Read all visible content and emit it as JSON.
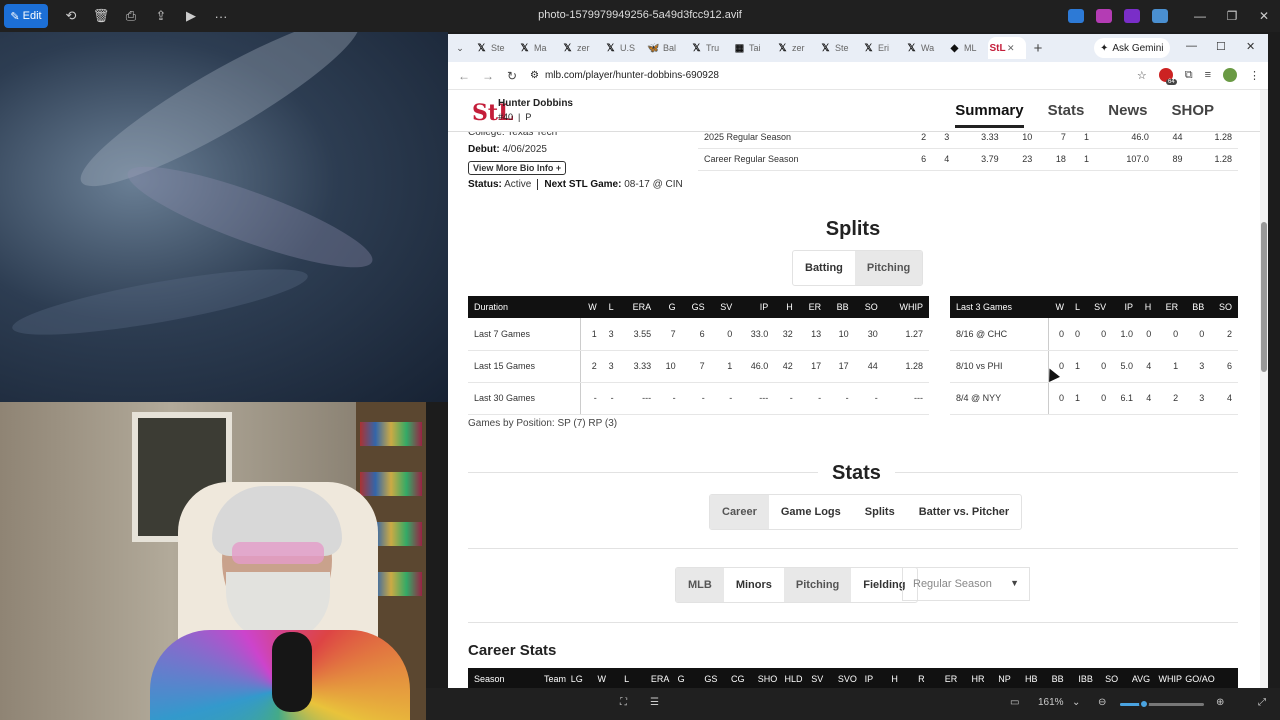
{
  "photos_app": {
    "edit_label": "Edit",
    "title": "photo-1579979949256-5a49d3fcc912.avif",
    "zoom_level": "161%",
    "zoom_fraction": 0.28
  },
  "browser": {
    "tabs": [
      {
        "icon": "𝕏",
        "label": "Ste"
      },
      {
        "icon": "𝕏",
        "label": "Ma"
      },
      {
        "icon": "𝕏",
        "label": "zer"
      },
      {
        "icon": "𝕏",
        "label": "U.S"
      },
      {
        "icon": "🦋",
        "label": "Bal"
      },
      {
        "icon": "𝕏",
        "label": "Tru"
      },
      {
        "icon": "▦",
        "label": "Tai"
      },
      {
        "icon": "𝕏",
        "label": "zer"
      },
      {
        "icon": "𝕏",
        "label": "Ste"
      },
      {
        "icon": "𝕏",
        "label": "Eri"
      },
      {
        "icon": "𝕏",
        "label": "Wa"
      },
      {
        "icon": "◆",
        "label": "ML"
      }
    ],
    "active_tab_icon": "StL",
    "gemini_label": "Ask Gemini",
    "url": "mlb.com/player/hunter-dobbins-690928",
    "extension_badge": "64"
  },
  "player": {
    "logo": "StL",
    "name": "Hunter Dobbins",
    "number": "#40",
    "position": "P",
    "nav": [
      "Summary",
      "Stats",
      "News",
      "SHOP"
    ],
    "college_cut": "College: Texas Tech",
    "debut_label": "Debut:",
    "debut_value": "4/06/2025",
    "more_bio": "View More Bio Info +",
    "status_label": "Status:",
    "status_value": "Active",
    "next_game_label": "Next STL Game:",
    "next_game_value": "08-17 @ CIN"
  },
  "summary_rows": [
    [
      "2025 Regular Season",
      "2",
      "3",
      "3.33",
      "10",
      "7",
      "1",
      "46.0",
      "44",
      "1.28"
    ],
    [
      "Career Regular Season",
      "6",
      "4",
      "3.79",
      "23",
      "18",
      "1",
      "107.0",
      "89",
      "1.28"
    ]
  ],
  "splits": {
    "title": "Splits",
    "toggle": [
      "Batting",
      "Pitching"
    ],
    "duration_headers": [
      "Duration",
      "W",
      "L",
      "ERA",
      "G",
      "GS",
      "SV",
      "IP",
      "H",
      "ER",
      "BB",
      "SO",
      "WHIP"
    ],
    "duration_rows": [
      [
        "Last 7 Games",
        "1",
        "3",
        "3.55",
        "7",
        "6",
        "0",
        "33.0",
        "32",
        "13",
        "10",
        "30",
        "1.27"
      ],
      [
        "Last 15 Games",
        "2",
        "3",
        "3.33",
        "10",
        "7",
        "1",
        "46.0",
        "42",
        "17",
        "17",
        "44",
        "1.28"
      ],
      [
        "Last 30 Games",
        "-",
        "-",
        "---",
        "-",
        "-",
        "-",
        "---",
        "-",
        "-",
        "-",
        "-",
        "---"
      ]
    ],
    "games_headers": [
      "Last 3 Games",
      "W",
      "L",
      "SV",
      "IP",
      "H",
      "ER",
      "BB",
      "SO"
    ],
    "games_rows": [
      [
        "8/16 @ CHC",
        "0",
        "0",
        "0",
        "1.0",
        "0",
        "0",
        "0",
        "2"
      ],
      [
        "8/10 vs PHI",
        "0",
        "1",
        "0",
        "5.0",
        "4",
        "1",
        "3",
        "6"
      ],
      [
        "8/4 @ NYY",
        "0",
        "1",
        "0",
        "6.1",
        "4",
        "2",
        "3",
        "4"
      ]
    ],
    "position_note": "Games by Position: SP (7) RP (3)"
  },
  "stats": {
    "title": "Stats",
    "tabs": [
      "Career",
      "Game Logs",
      "Splits",
      "Batter vs. Pitcher"
    ],
    "filters": [
      "MLB",
      "Minors",
      "Pitching",
      "Fielding"
    ],
    "season_select": "Regular Season",
    "career_title": "Career Stats",
    "career_headers": [
      "Season",
      "Team",
      "LG",
      "W",
      "L",
      "ERA",
      "G",
      "GS",
      "CG",
      "SHO",
      "HLD",
      "SV",
      "SVO",
      "IP",
      "H",
      "R",
      "ER",
      "HR",
      "NP",
      "HB",
      "BB",
      "IBB",
      "SO",
      "AVG",
      "WHIP",
      "GO/AO"
    ]
  },
  "colors": {
    "cardinals_red": "#c41e3a",
    "table_header": "#111111",
    "edit_blue": "#1c6fd6"
  }
}
